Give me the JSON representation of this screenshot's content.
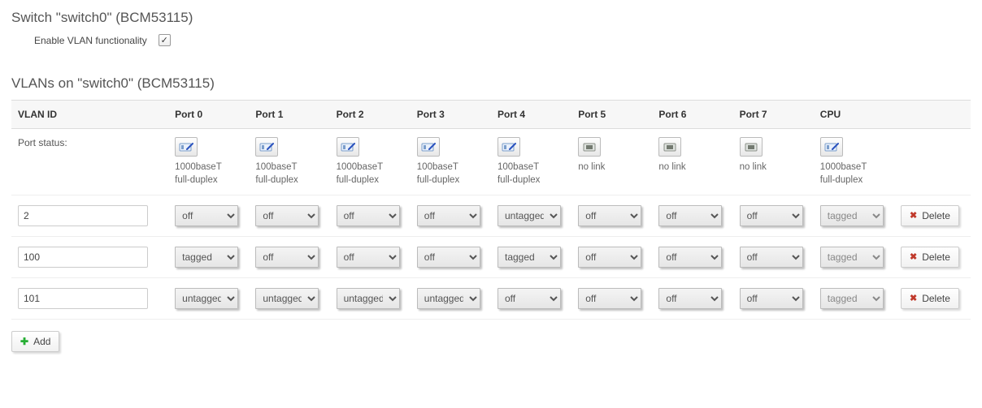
{
  "switch_section": {
    "title": "Switch \"switch0\" (BCM53115)",
    "enable_label": "Enable VLAN functionality",
    "enable_checked": true
  },
  "vlans_section": {
    "title": "VLANs on \"switch0\" (BCM53115)",
    "columns": [
      "VLAN ID",
      "Port 0",
      "Port 1",
      "Port 2",
      "Port 3",
      "Port 4",
      "Port 5",
      "Port 6",
      "Port 7",
      "CPU"
    ],
    "port_status_label": "Port status:",
    "ports": [
      {
        "link": true,
        "line1": "1000baseT",
        "line2": "full-duplex"
      },
      {
        "link": true,
        "line1": "100baseT",
        "line2": "full-duplex"
      },
      {
        "link": true,
        "line1": "1000baseT",
        "line2": "full-duplex"
      },
      {
        "link": true,
        "line1": "100baseT",
        "line2": "full-duplex"
      },
      {
        "link": true,
        "line1": "100baseT",
        "line2": "full-duplex"
      },
      {
        "link": false,
        "line1": "no link",
        "line2": ""
      },
      {
        "link": false,
        "line1": "no link",
        "line2": ""
      },
      {
        "link": false,
        "line1": "no link",
        "line2": ""
      },
      {
        "link": true,
        "line1": "1000baseT",
        "line2": "full-duplex"
      }
    ],
    "vlan_options": [
      "off",
      "untagged",
      "tagged"
    ],
    "rows": [
      {
        "vlan_id": "2",
        "values": [
          "off",
          "off",
          "off",
          "off",
          "untagged",
          "off",
          "off",
          "off",
          "tagged"
        ],
        "cpu_disabled": true
      },
      {
        "vlan_id": "100",
        "values": [
          "tagged",
          "off",
          "off",
          "off",
          "tagged",
          "off",
          "off",
          "off",
          "tagged"
        ],
        "cpu_disabled": true
      },
      {
        "vlan_id": "101",
        "values": [
          "untagged",
          "untagged",
          "untagged",
          "untagged",
          "off",
          "off",
          "off",
          "off",
          "tagged"
        ],
        "cpu_disabled": true
      }
    ],
    "delete_label": "Delete",
    "add_label": "Add"
  }
}
